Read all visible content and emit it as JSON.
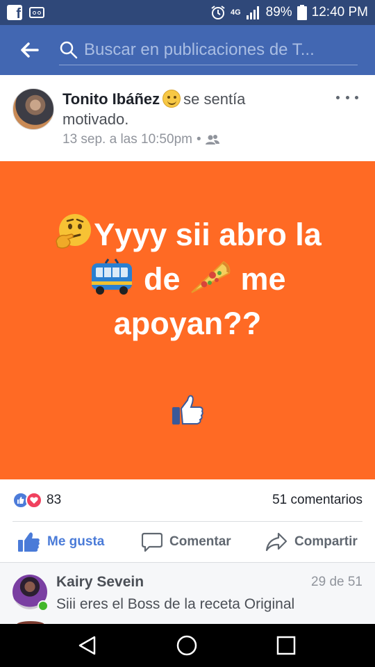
{
  "status_bar": {
    "battery_percent": "89%",
    "time": "12:40 PM",
    "network_label": "4G"
  },
  "search": {
    "placeholder": "Buscar en publicaciones de T..."
  },
  "post": {
    "author": "Tonito Ibáñez",
    "feeling_text": "se sentía",
    "feeling_value": "motivado.",
    "time": "13 sep. a las 10:50pm",
    "privacy_separator": "•",
    "image": {
      "background_color": "#ff6a24",
      "line1": "Yyyy sii abro la",
      "line2_word1": "de",
      "line2_word2": "me",
      "line3": "apoyan??",
      "emojis": [
        "thinking-face-emoji",
        "trolleybus-emoji",
        "pizza-emoji",
        "thumbs-up-emoji"
      ]
    },
    "reactions": {
      "count": "83",
      "types": [
        "like",
        "love"
      ]
    },
    "comments_count": "51 comentarios"
  },
  "actions": {
    "like_label": "Me gusta",
    "comment_label": "Comentar",
    "share_label": "Compartir"
  },
  "comment": {
    "author": "Kairy Sevein",
    "counter": "29 de 51",
    "text": "Siii eres el Boss de la receta Original",
    "online": true
  },
  "colors": {
    "status_bar": "#2f4879",
    "header": "#4267b2",
    "like_blue": "#4a7bd8",
    "love_red": "#f0415e"
  }
}
